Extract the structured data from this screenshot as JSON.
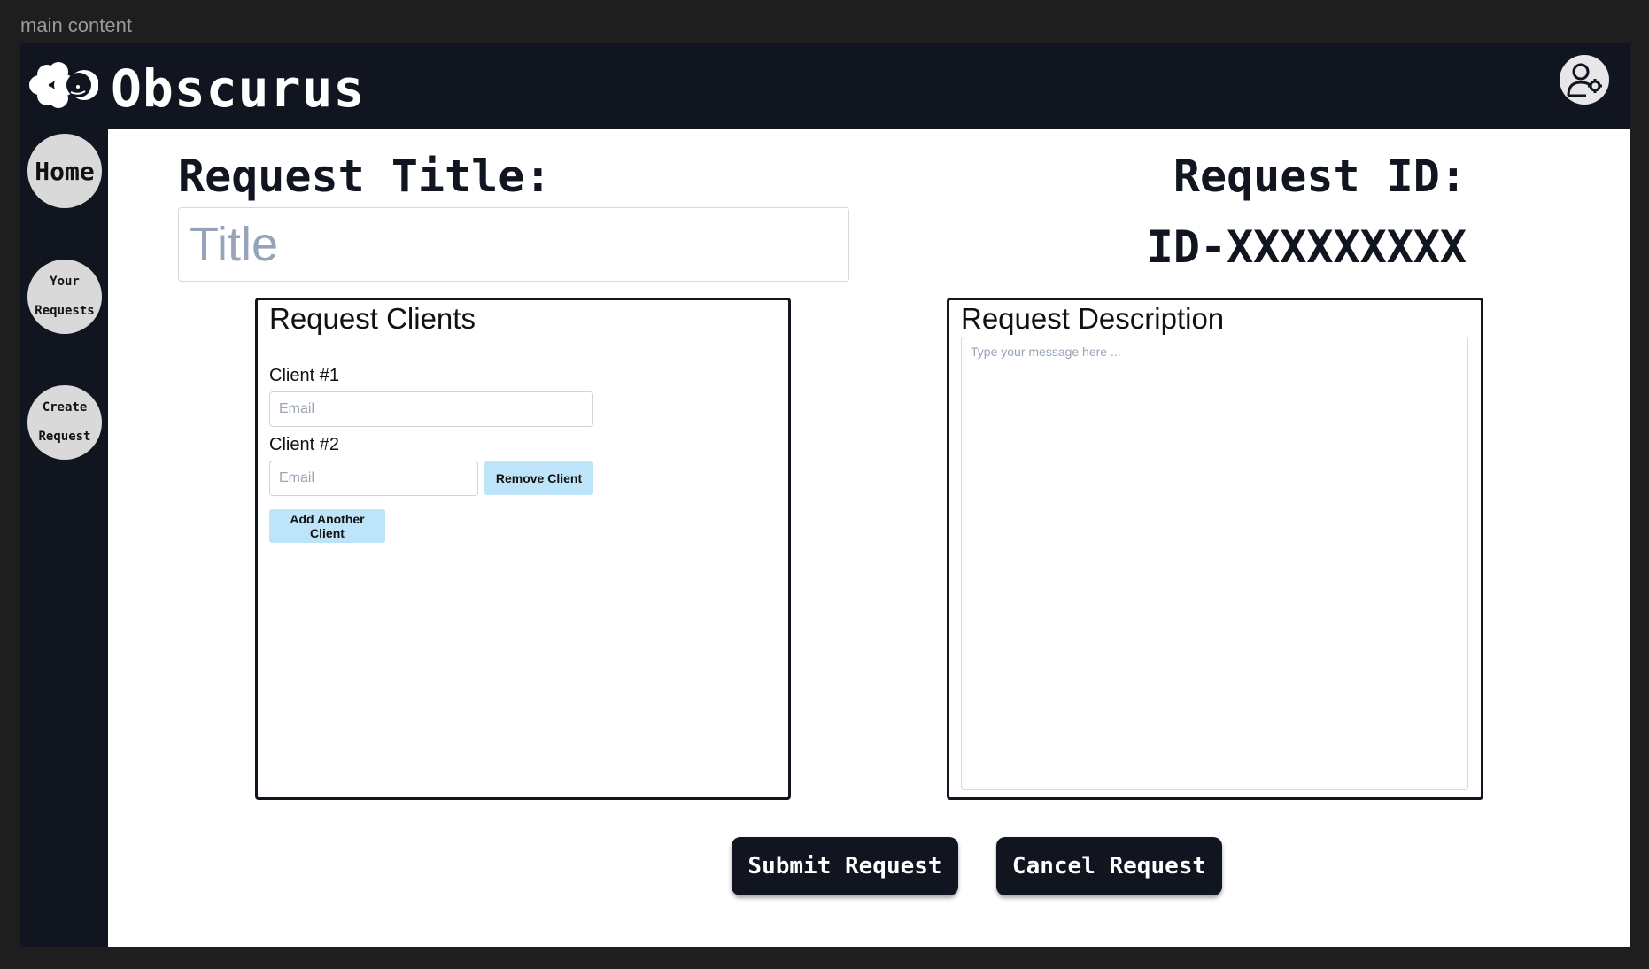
{
  "frame": {
    "label": "main content"
  },
  "app": {
    "name": "Obscurus"
  },
  "icons": {
    "logo": "cloud-moon-logo-icon",
    "profile": "user-settings-icon"
  },
  "sidebar": {
    "items": [
      {
        "label": "Home"
      },
      {
        "label_line1": "Your",
        "label_line2": "Requests"
      },
      {
        "label_line1": "Create",
        "label_line2": "Request"
      }
    ]
  },
  "form": {
    "title_label": "Request Title:",
    "title_placeholder": "Title",
    "id_label": "Request ID:",
    "id_value": "ID-XXXXXXXXX"
  },
  "clients": {
    "heading": "Request Clients",
    "items": [
      {
        "label": "Client #1",
        "placeholder": "Email"
      },
      {
        "label": "Client #2",
        "placeholder": "Email",
        "remove_label": "Remove Client"
      }
    ],
    "add_label": "Add Another Client"
  },
  "description": {
    "heading": "Request Description",
    "placeholder": "Type your message here ..."
  },
  "actions": {
    "submit_label": "Submit Request",
    "cancel_label": "Cancel Request"
  },
  "colors": {
    "app_dark": "#111520",
    "button_light_blue": "#bde4f8",
    "nav_circle": "#d9d9d9"
  }
}
